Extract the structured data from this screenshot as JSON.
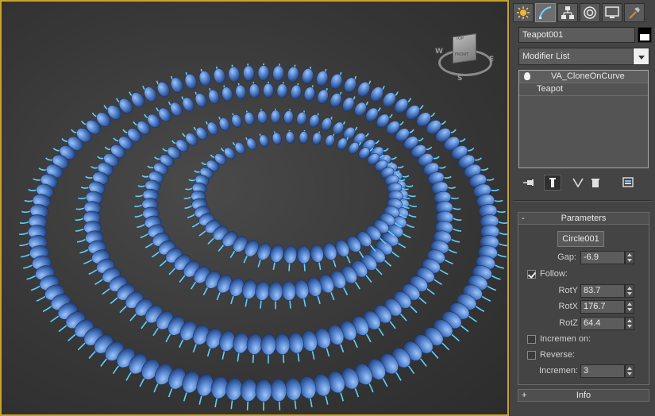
{
  "tabs": [
    {
      "name": "create-tab",
      "icon": "sun-icon"
    },
    {
      "name": "modify-tab",
      "icon": "curve-icon",
      "active": true
    },
    {
      "name": "hierarchy-tab",
      "icon": "hierarchy-icon"
    },
    {
      "name": "motion-tab",
      "icon": "motion-icon"
    },
    {
      "name": "display-tab",
      "icon": "monitor-icon"
    },
    {
      "name": "utilities-tab",
      "icon": "hammer-icon"
    }
  ],
  "object": {
    "name": "Teapot001",
    "color": "#000000"
  },
  "modifier_list": {
    "label": "Modifier List"
  },
  "stack": {
    "items": [
      {
        "label": "VA_CloneOnCurve",
        "has_bulb": true
      },
      {
        "label": "Teapot",
        "has_bulb": false
      }
    ]
  },
  "viewcube": {
    "top": "TOP",
    "front": "FRONT",
    "w": "W",
    "e": "E",
    "s": "S"
  },
  "parameters": {
    "title": "Parameters",
    "collapse_sign": "-",
    "curve_button": "Circle001",
    "gap_label": "Gap:",
    "gap_value": "-6.9",
    "follow_label": "Follow:",
    "follow_checked": true,
    "roty_label": "RotY",
    "roty_value": "83.7",
    "rotx_label": "RotX",
    "rotx_value": "176.7",
    "rotz_label": "RotZ",
    "rotz_value": "64.4",
    "increment_on_label": "Incremen on:",
    "increment_on_checked": false,
    "reverse_label": "Reverse:",
    "reverse_checked": false,
    "increment_label": "Incremen:",
    "increment_value": "3"
  },
  "info": {
    "title": "Info",
    "expand_sign": "+"
  },
  "colors": {
    "viewport_border": "#c9a227",
    "teapot_blue": "#4f7fc9",
    "handle_cyan": "#5fd0ff"
  }
}
